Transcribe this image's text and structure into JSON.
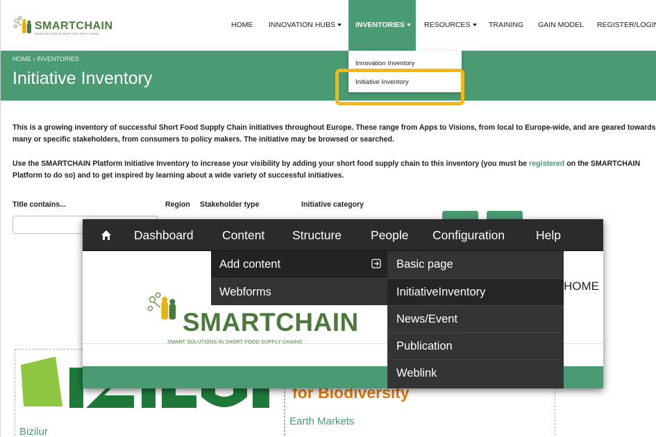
{
  "site": {
    "logo": {
      "name": "SMARTCHAIN",
      "tagline": "SMART SOLUTIONS IN SHORT FOOD SUPPLY CHAINS"
    },
    "nav": [
      {
        "label": "HOME"
      },
      {
        "label": "INNOVATION HUBS"
      },
      {
        "label": "INVENTORIES"
      },
      {
        "label": "RESOURCES"
      },
      {
        "label": "TRAINING"
      },
      {
        "label": "GAIN MODEL"
      },
      {
        "label": "REGISTER/LOGIN"
      }
    ],
    "dropdown": [
      {
        "label": "Innovation Inventory"
      },
      {
        "label": "Initiative Inventory"
      }
    ],
    "breadcrumb": "HOME  ›  INVENTORIES",
    "page_title": "Initiative Inventory",
    "intro1": "This is a growing inventory of successful Short Food Supply Chain initiatives throughout Europe. These range from Apps to Visions, from local to Europe-wide, and are geared towards many or specific stakeholders, from consumers to policy makers. The initiative may be browsed or searched.",
    "intro2_before": "Use the SMARTCHAIN Platform Initiative Inventory to increase your visibility by adding your short food supply chain to this inventory (you must be ",
    "intro2_link": "registered",
    "intro2_after": " on the SMARTCHAIN Platform to do so) and to get inspired by learning about a wide variety of successful initiatives.",
    "filters": {
      "title": "Title contains...",
      "region": "Region",
      "stakeholder": "Stakeholder type",
      "category": "Initiative category"
    },
    "cards": [
      {
        "logo_text": "BIZILUR",
        "label": "Bizilur"
      },
      {
        "logo_text": "for Biodiversity",
        "label": "Earth Markets"
      }
    ]
  },
  "admin": {
    "toolbar": [
      {
        "label": "Dashboard"
      },
      {
        "label": "Content"
      },
      {
        "label": "Structure"
      },
      {
        "label": "People"
      },
      {
        "label": "Configuration"
      },
      {
        "label": "Help"
      }
    ],
    "content_menu": [
      {
        "label": "Add content"
      },
      {
        "label": "Webforms"
      }
    ],
    "add_content_menu": [
      {
        "label": "Basic page"
      },
      {
        "label": "InitiativeInventory"
      },
      {
        "label": "News/Event"
      },
      {
        "label": "Publication"
      },
      {
        "label": "Weblink"
      }
    ],
    "page_home": "HOME",
    "logo": {
      "name": "SMARTCHAIN",
      "tagline": "SMART SOLUTIONS IN SHORT FOOD SUPPLY CHAINS"
    }
  },
  "colors": {
    "green": "#4a9b74",
    "highlight": "#f6b80e",
    "toolbar": "#2b2b2b"
  },
  "icons": [
    "home-icon",
    "caret-down-icon",
    "submenu-arrow-icon",
    "smartchain-logo-icon"
  ]
}
